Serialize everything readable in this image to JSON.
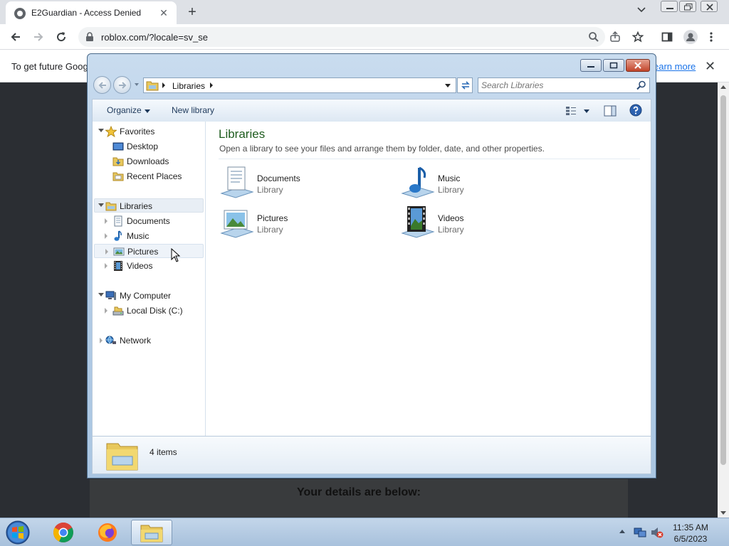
{
  "browser": {
    "tab_title": "E2Guardian - Access Denied",
    "tab_close": "✕",
    "new_tab": "+",
    "url": "roblox.com/?locale=sv_se",
    "infobar_text": "To get future Goog",
    "infobar_link": "earn more",
    "infobar_close": "✕",
    "page_details_text": "Your details are below:"
  },
  "explorer": {
    "address": {
      "crumb": "Libraries"
    },
    "search_placeholder": "Search Libraries",
    "toolbar": {
      "organize": "Organize",
      "new_library": "New library"
    },
    "nav": {
      "favorites": "Favorites",
      "desktop": "Desktop",
      "downloads": "Downloads",
      "recent_places": "Recent Places",
      "libraries": "Libraries",
      "documents": "Documents",
      "music": "Music",
      "pictures": "Pictures",
      "videos": "Videos",
      "my_computer": "My Computer",
      "local_disk": "Local Disk (C:)",
      "network": "Network"
    },
    "content": {
      "title": "Libraries",
      "subtitle": "Open a library to see your files and arrange them by folder, date, and other properties.",
      "items": [
        {
          "name": "Documents",
          "type": "Library",
          "icon": "documents-library-icon"
        },
        {
          "name": "Music",
          "type": "Library",
          "icon": "music-library-icon"
        },
        {
          "name": "Pictures",
          "type": "Library",
          "icon": "pictures-library-icon"
        },
        {
          "name": "Videos",
          "type": "Library",
          "icon": "videos-library-icon"
        }
      ]
    },
    "details": {
      "count": "4 items"
    }
  },
  "taskbar": {
    "time": "11:35 AM",
    "date": "6/5/2023"
  },
  "colors": {
    "content_title": "#1e5c1e",
    "link": "#1a73e8",
    "page_bg": "#2b2e33"
  }
}
